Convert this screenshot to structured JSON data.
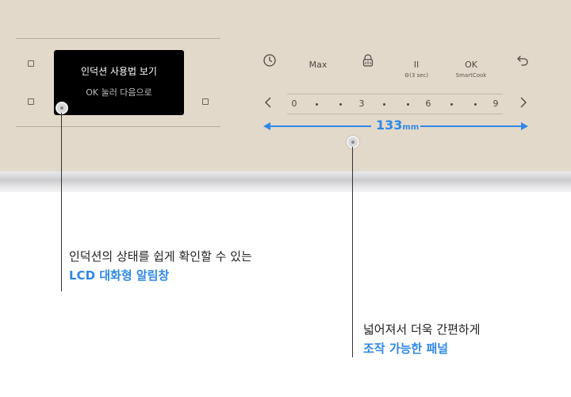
{
  "lcd": {
    "title": "인덕션 사용법 보기",
    "subtitle": "OK 눌러 다음으로"
  },
  "controls": {
    "timer_icon": "timer-icon",
    "max_label": "Max",
    "lock_icon": "child-lock-icon",
    "pause_label": "II",
    "pause_sub": "⚙(3 sec)",
    "ok_label": "OK",
    "ok_sub": "SmartCook",
    "back_icon": "back-arrow-icon"
  },
  "scale": {
    "left_icon": "chevron-left-icon",
    "right_icon": "chevron-right-icon",
    "labels": [
      "0",
      "3",
      "6",
      "9"
    ]
  },
  "measurement": {
    "value": "133",
    "unit": "mm",
    "color": "#2f88e8"
  },
  "captions": {
    "lcd_line1": "인덕션의 상태를 쉽게 확인할 수 있는",
    "lcd_line2": "LCD 대화형 알림창",
    "panel_line1": "넓어져서 더욱 간편하게",
    "panel_line2": "조작 가능한 패널"
  }
}
